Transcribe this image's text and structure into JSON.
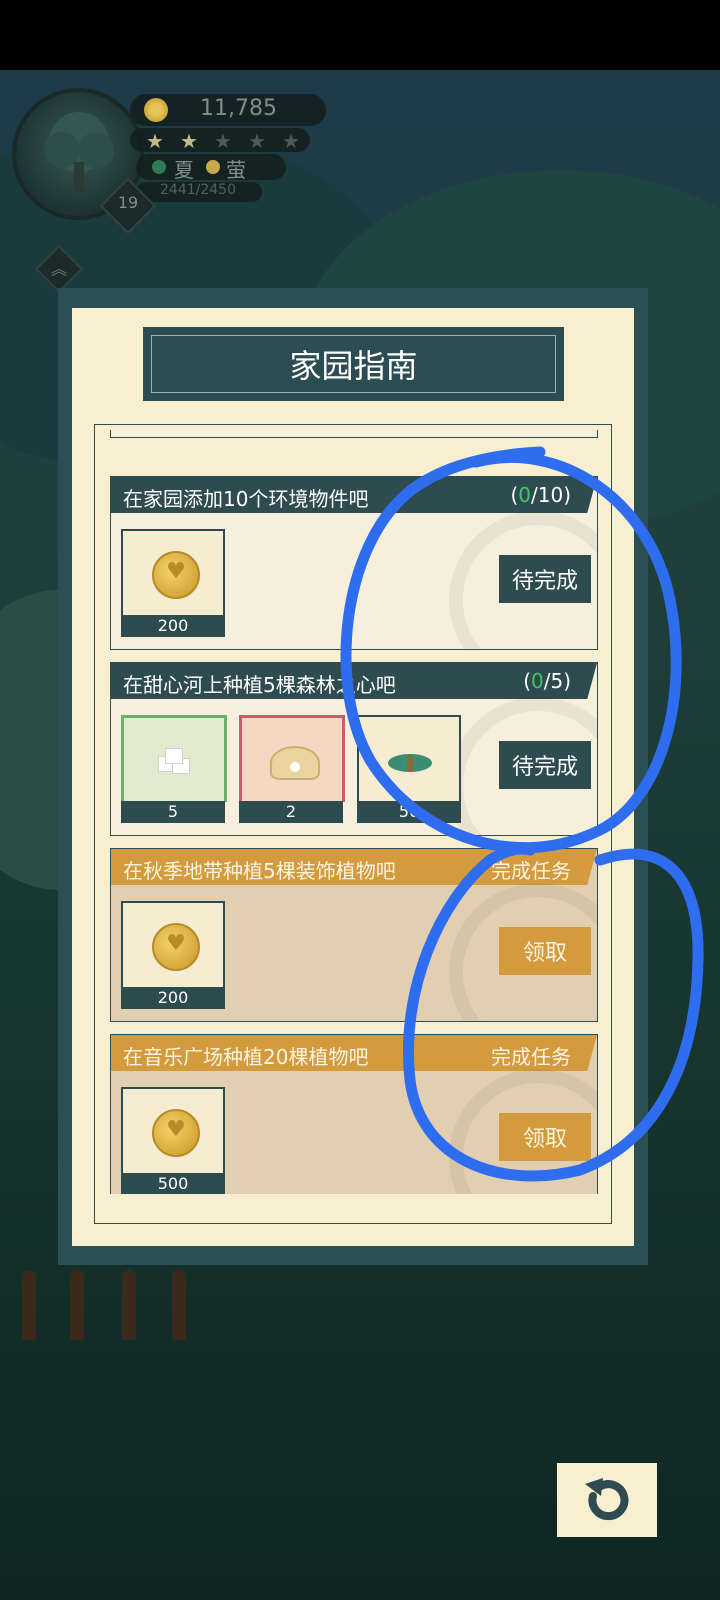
{
  "hud": {
    "coins": "11,785",
    "stars_total": 5,
    "stars_filled": 2,
    "season": "夏",
    "period": "萤",
    "xp": "2441/2450",
    "level": "19"
  },
  "dialog": {
    "title": "家园指南"
  },
  "tasks": [
    {
      "title": "在家园添加10个环境物件吧",
      "progress_current": "0",
      "progress_total": "/10)",
      "progress_open": "(",
      "status": "pending",
      "button": "待完成",
      "rewards": [
        {
          "icon": "coin-icon",
          "count": "200"
        }
      ]
    },
    {
      "title": "在甜心河上种植5棵森林之心吧",
      "progress_current": "0",
      "progress_total": "/5)",
      "progress_open": "(",
      "status": "pending",
      "button": "待完成",
      "rewards": [
        {
          "icon": "sugar-cube-icon",
          "count": "5"
        },
        {
          "icon": "pearl-shell-icon",
          "count": "2"
        },
        {
          "icon": "herb-bundle-icon",
          "count": "50"
        }
      ]
    },
    {
      "title": "在秋季地带种植5棵装饰植物吧",
      "progress_label": "完成任务",
      "status": "done",
      "button": "领取",
      "rewards": [
        {
          "icon": "coin-icon",
          "count": "200"
        }
      ]
    },
    {
      "title": "在音乐广场种植20棵植物吧",
      "progress_label": "完成任务",
      "status": "done",
      "button": "领取",
      "rewards": [
        {
          "icon": "coin-icon",
          "count": "500"
        }
      ]
    }
  ],
  "colors": {
    "panel_dark": "#2a4f55",
    "panel_light": "#f8efd1",
    "accent_orange": "#d39a3e",
    "progress_green": "#41c46b",
    "annotation_blue": "#2f6df0"
  }
}
